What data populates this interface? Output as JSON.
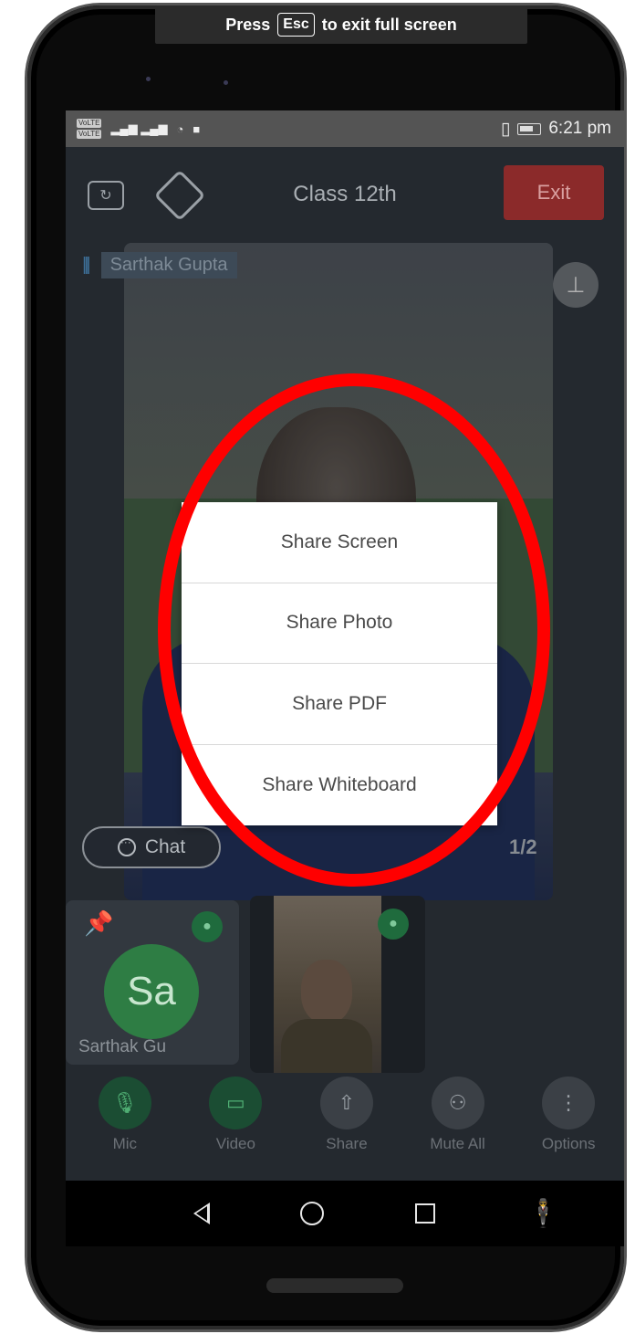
{
  "banner": {
    "press": "Press",
    "key": "Esc",
    "message": "to exit full screen"
  },
  "statusbar": {
    "time": "6:21 pm",
    "sim1": "VoLTE",
    "sim2": "VoLTE"
  },
  "appbar": {
    "title": "Class 12th",
    "exit_label": "Exit"
  },
  "speaker": {
    "name": "Sarthak Gupta"
  },
  "chat": {
    "label": "Chat"
  },
  "page_counter": "1/2",
  "participants": [
    {
      "initials": "Sa",
      "name": "Sarthak Gu"
    }
  ],
  "share_menu": {
    "items": [
      "Share Screen",
      "Share Photo",
      "Share PDF",
      "Share Whiteboard"
    ]
  },
  "toolbar": {
    "items": [
      {
        "label": "Mic",
        "icon": "mic-icon"
      },
      {
        "label": "Video",
        "icon": "video-camera-icon"
      },
      {
        "label": "Share",
        "icon": "share-icon"
      },
      {
        "label": "Mute All",
        "icon": "mute-all-icon"
      },
      {
        "label": "Options",
        "icon": "more-vertical-icon"
      }
    ]
  },
  "colors": {
    "highlight": "#ff0000",
    "exit": "#8b2a2a",
    "active_green": "#1b4d33"
  }
}
